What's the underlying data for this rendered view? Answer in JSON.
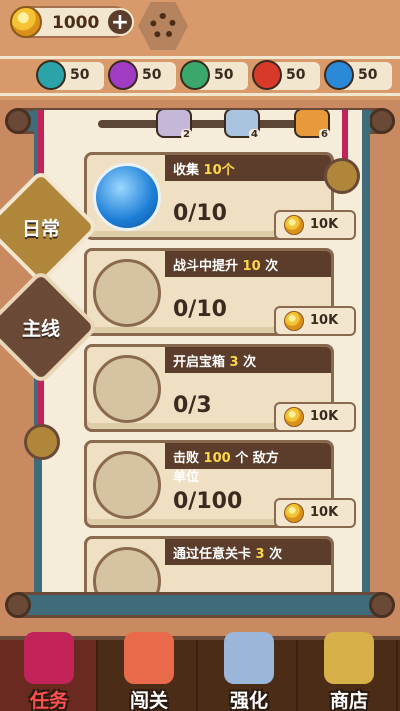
{
  "top_bar": {
    "coins": "1000",
    "plus_icon": "plus-icon",
    "settings_icon": "gear-icon"
  },
  "resources": [
    {
      "value": "50",
      "color": "#2aa4a8",
      "icon": "teal-gem-icon"
    },
    {
      "value": "50",
      "color": "#a03cc4",
      "icon": "purple-gem-icon"
    },
    {
      "value": "50",
      "color": "#3aa86a",
      "icon": "green-gem-icon"
    },
    {
      "value": "50",
      "color": "#d83a2a",
      "icon": "red-gem-icon"
    },
    {
      "value": "50",
      "color": "#2a8ad8",
      "icon": "blue-gem-icon"
    }
  ],
  "milestones": [
    {
      "label": "2",
      "color": "#c4b7d8"
    },
    {
      "label": "4",
      "color": "#a8c4de"
    },
    {
      "label": "6",
      "color": "#e89a3a"
    }
  ],
  "side_tabs": [
    {
      "label": "日常",
      "active": true
    },
    {
      "label": "主线",
      "active": false
    }
  ],
  "tasks": [
    {
      "title_pre": "收集",
      "title_num": "10个",
      "title_post": "",
      "progress": "0/10",
      "reward": "10K",
      "has_reward": true,
      "active_icon": true
    },
    {
      "title_pre": "战斗中提升",
      "title_num": "10",
      "title_post": "次",
      "progress": "0/10",
      "reward": "10K",
      "has_reward": true,
      "active_icon": false
    },
    {
      "title_pre": "开启宝箱",
      "title_num": "3",
      "title_post": "次",
      "progress": "0/3",
      "reward": "10K",
      "has_reward": true,
      "active_icon": false
    },
    {
      "title_pre": "击败",
      "title_num": "100",
      "title_post": "个 敌方\n单位",
      "progress": "0/100",
      "reward": "10K",
      "has_reward": true,
      "active_icon": false
    },
    {
      "title_pre": "通过任意关卡",
      "title_num": "3",
      "title_post": "次",
      "progress": "",
      "reward": "",
      "has_reward": false,
      "active_icon": false
    }
  ],
  "bottom_nav": [
    {
      "label": "任务",
      "active": true,
      "color": "#c2245a"
    },
    {
      "label": "闯关",
      "active": false,
      "color": "#e86a4a"
    },
    {
      "label": "强化",
      "active": false,
      "color": "#9ab6d8"
    },
    {
      "label": "商店",
      "active": false,
      "color": "#d8b04a"
    }
  ]
}
